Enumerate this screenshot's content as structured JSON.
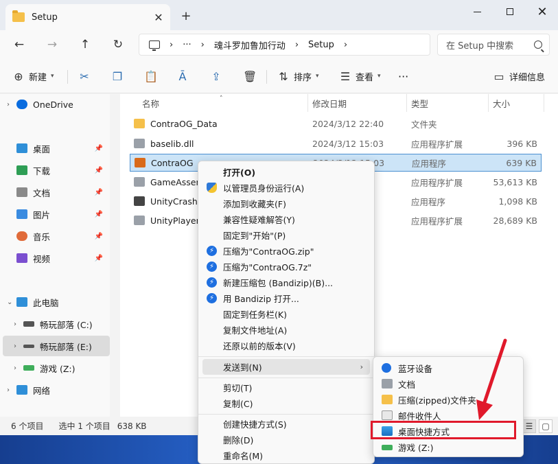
{
  "tab": {
    "title": "Setup",
    "close": "✕",
    "new": "+"
  },
  "address": {
    "ellipsis": "···",
    "crumbs": [
      "魂斗罗加鲁加行动",
      "Setup"
    ],
    "search_placeholder": "在 Setup 中搜索"
  },
  "toolbar": {
    "new_label": "新建",
    "sort_label": "排序",
    "view_label": "查看",
    "more": "···",
    "details_label": "详细信息"
  },
  "sidebar": {
    "items": [
      {
        "label": "OneDrive",
        "color": "#0a6cdf"
      },
      {
        "label": "桌面",
        "color": "#2f8fd8"
      },
      {
        "label": "下载",
        "color": "#2e9e55"
      },
      {
        "label": "文档",
        "color": "#8a8a8a"
      },
      {
        "label": "图片",
        "color": "#3a8be0"
      },
      {
        "label": "音乐",
        "color": "#e06b3a"
      },
      {
        "label": "视频",
        "color": "#7b4fd0"
      },
      {
        "label": "此电脑",
        "color": "#2f8fd8"
      },
      {
        "label": "畅玩部落 (C:)",
        "color": "#555555"
      },
      {
        "label": "畅玩部落 (E:)",
        "color": "#555555"
      },
      {
        "label": "游戏 (Z:)",
        "color": "#3fae5b"
      },
      {
        "label": "网络",
        "color": "#2f8fd8"
      }
    ]
  },
  "columns": {
    "name": "名称",
    "modified": "修改日期",
    "type": "类型",
    "size": "大小"
  },
  "files": [
    {
      "name": "ContraOG_Data",
      "modified": "2024/3/12 22:40",
      "type": "文件夹",
      "size": "",
      "color": "#f5c04a"
    },
    {
      "name": "baselib.dll",
      "modified": "2024/3/12 15:03",
      "type": "应用程序扩展",
      "size": "396 KB",
      "color": "#9aa0a8"
    },
    {
      "name": "ContraOG",
      "modified": "2024/3/12 15:03",
      "type": "应用程序",
      "size": "639 KB",
      "color": "#d96a1a"
    },
    {
      "name": "GameAssem",
      "modified": "",
      "type": "应用程序扩展",
      "size": "53,613 KB",
      "color": "#9aa0a8"
    },
    {
      "name": "UnityCrashHa",
      "modified": "",
      "type": "应用程序",
      "size": "1,098 KB",
      "color": "#444444"
    },
    {
      "name": "UnityPlayer.d",
      "modified": "",
      "type": "应用程序扩展",
      "size": "28,689 KB",
      "color": "#9aa0a8"
    }
  ],
  "status": {
    "count": "6 个项目",
    "selected": "选中 1 个项目",
    "size": "638 KB"
  },
  "context_menu": {
    "open": "打开(O)",
    "run_admin": "以管理员身份运行(A)",
    "add_fav": "添加到收藏夹(F)",
    "compat": "兼容性疑难解答(Y)",
    "pin_start": "固定到\"开始\"(P)",
    "zip": "压缩为\"ContraOG.zip\"",
    "7z": "压缩为\"ContraOG.7z\"",
    "new_archive": "新建压缩包 (Bandizip)(B)...",
    "open_bandizip": "用 Bandizip 打开...",
    "pin_taskbar": "固定到任务栏(K)",
    "copy_path": "复制文件地址(A)",
    "restore": "还原以前的版本(V)",
    "send_to": "发送到(N)",
    "cut": "剪切(T)",
    "copy": "复制(C)",
    "create_shortcut": "创建快捷方式(S)",
    "delete": "删除(D)",
    "rename": "重命名(M)"
  },
  "submenu": {
    "bluetooth": "蓝牙设备",
    "documents": "文档",
    "zipped": "压缩(zipped)文件夹",
    "mail": "邮件收件人",
    "desktop_shortcut": "桌面快捷方式",
    "games": "游戏 (Z:)"
  },
  "colors": {
    "accent": "#0a6cdf",
    "selection": "#cce4f7",
    "annotation_red": "#e0192b"
  }
}
